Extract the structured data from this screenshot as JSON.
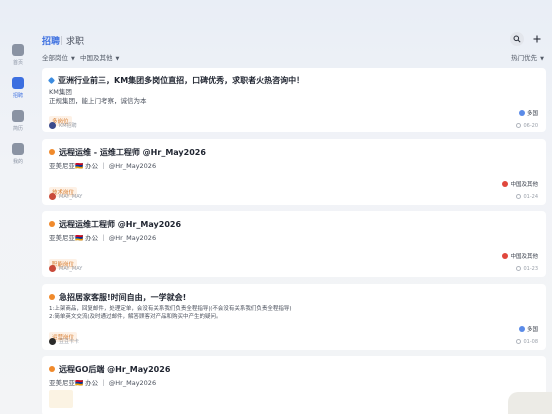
{
  "sidebar": {
    "items": [
      {
        "label": "首页",
        "icon": "home-icon",
        "active": false
      },
      {
        "label": "招聘",
        "icon": "jobs-icon",
        "active": true
      },
      {
        "label": "简历",
        "icon": "resume-icon",
        "active": false
      },
      {
        "label": "我的",
        "icon": "profile-icon",
        "active": false
      }
    ]
  },
  "header": {
    "tabs": [
      {
        "label": "招聘",
        "active": true
      },
      {
        "label": "求职",
        "active": false
      }
    ],
    "search_icon": "search-icon",
    "add_icon": "plus-icon"
  },
  "filters": {
    "category": "全部岗位",
    "region": "中国及其他",
    "sort": "热门优先"
  },
  "cards": [
    {
      "title": "亚洲行业前三，KM集团多岗位直招，口碑优秀，求职者火热咨询中！",
      "lines": [
        "KM集团",
        "正规集团，能上门考察，诚信为本"
      ],
      "tag": "多岗位",
      "location": "多国",
      "author": "KM招聘",
      "time": "06-20"
    },
    {
      "title": "远程运维 - 运维工程师 @Hr_May2026",
      "lines": [
        "亚美尼亚🇦🇲 办公 ｜ @Hr_May2026"
      ],
      "tag": "技术岗位",
      "location": "中国及其他",
      "author": "MAY_MAY",
      "time": "01-24"
    },
    {
      "title": "远程运维工程师 @Hr_May2026",
      "lines": [
        "亚美尼亚🇦🇲 办公 ｜ @Hr_May2026"
      ],
      "tag": "职能岗位",
      "location": "中国及其他",
      "author": "MAY_MAY",
      "time": "01-23"
    },
    {
      "title": "急招居家客服!时间自由，一学就会!",
      "lines": [
        "1:上架商品，回复邮件，处理定单，会没有关系我们负责全程指导|(不会没有关系我们负责全程指导)",
        "2:简单英文交流(及时通过邮件，解答顾客对产品和购买中产生的疑问。"
      ],
      "tag": "运营岗位",
      "location": "多国",
      "author": "豆豆卡卡",
      "time": "01-08"
    },
    {
      "title": "远程GO后端 @Hr_May2026",
      "lines": [
        "亚美尼亚🇦🇲 办公 ｜ @Hr_May2026"
      ],
      "tag": "",
      "location": "",
      "author": "",
      "time": ""
    }
  ],
  "colors": {
    "accent": "#3c6fe0",
    "tag_text": "#d67b2e",
    "tag_bg": "#fdf1e6"
  }
}
